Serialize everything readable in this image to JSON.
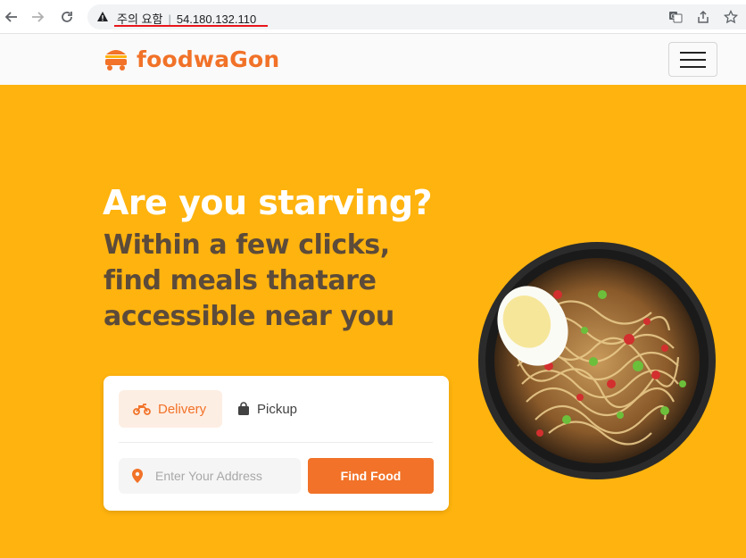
{
  "browser": {
    "security_label": "주의 요함",
    "url": "54.180.132.110"
  },
  "site": {
    "logo_text": "foodwaGon",
    "brand_color": "#F17228",
    "hero_bg": "#FFB30E"
  },
  "hero": {
    "title": "Are you starving?",
    "subtitle": "Within a few clicks, find meals thatare accessible near you"
  },
  "search_card": {
    "tabs": [
      {
        "label": "Delivery",
        "icon": "motorcycle-icon",
        "active": true
      },
      {
        "label": "Pickup",
        "icon": "shopping-bag-icon",
        "active": false
      }
    ],
    "address_placeholder": "Enter Your Address",
    "find_button": "Find Food"
  }
}
